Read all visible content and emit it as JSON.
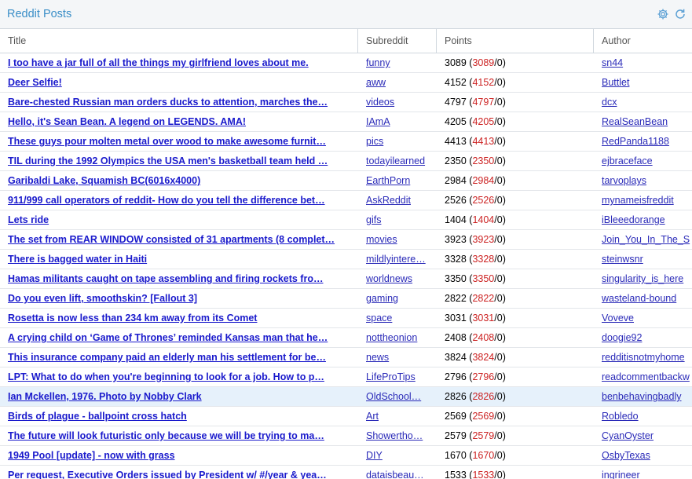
{
  "panel": {
    "title": "Reddit Posts",
    "icons": [
      "gear-icon",
      "refresh-icon"
    ],
    "accent": "#3a8ec7"
  },
  "columns": [
    "Title",
    "Subreddit",
    "Points",
    "Author"
  ],
  "rows": [
    {
      "title": "I too have a jar full of all the things my girlfriend loves about me.",
      "subreddit": "funny",
      "points": "3089",
      "ups": "3089",
      "downs": "0",
      "author": "sn44"
    },
    {
      "title": "Deer Selfie!",
      "subreddit": "aww",
      "points": "4152",
      "ups": "4152",
      "downs": "0",
      "author": "Buttlet"
    },
    {
      "title": "Bare-chested Russian man orders ducks to attention, marches the…",
      "subreddit": "videos",
      "points": "4797",
      "ups": "4797",
      "downs": "0",
      "author": "dcx"
    },
    {
      "title": "Hello, it's Sean Bean. A legend on LEGENDS. AMA!",
      "subreddit": "IAmA",
      "points": "4205",
      "ups": "4205",
      "downs": "0",
      "author": "RealSeanBean"
    },
    {
      "title": "These guys pour molten metal over wood to make awesome furnit…",
      "subreddit": "pics",
      "points": "4413",
      "ups": "4413",
      "downs": "0",
      "author": "RedPanda1188"
    },
    {
      "title": "TIL during the 1992 Olympics the USA men's basketball team held …",
      "subreddit": "todayilearned",
      "points": "2350",
      "ups": "2350",
      "downs": "0",
      "author": "ejbraceface"
    },
    {
      "title": "Garibaldi Lake, Squamish BC(6016x4000)",
      "subreddit": "EarthPorn",
      "points": "2984",
      "ups": "2984",
      "downs": "0",
      "author": "tarvoplays"
    },
    {
      "title": "911/999 call operators of reddit- How do you tell the difference bet…",
      "subreddit": "AskReddit",
      "points": "2526",
      "ups": "2526",
      "downs": "0",
      "author": "mynameisfreddit"
    },
    {
      "title": "Lets ride",
      "subreddit": "gifs",
      "points": "1404",
      "ups": "1404",
      "downs": "0",
      "author": "iBleeedorange"
    },
    {
      "title": "The set from REAR WINDOW consisted of 31 apartments (8 complet…",
      "subreddit": "movies",
      "points": "3923",
      "ups": "3923",
      "downs": "0",
      "author": "Join_You_In_The_S"
    },
    {
      "title": "There is bagged water in Haiti",
      "subreddit": "mildlyintere…",
      "points": "3328",
      "ups": "3328",
      "downs": "0",
      "author": "steinwsnr"
    },
    {
      "title": "Hamas militants caught on tape assembling and firing rockets fro…",
      "subreddit": "worldnews",
      "points": "3350",
      "ups": "3350",
      "downs": "0",
      "author": "singularity_is_here"
    },
    {
      "title": "Do you even lift, smoothskin? [Fallout 3]",
      "subreddit": "gaming",
      "points": "2822",
      "ups": "2822",
      "downs": "0",
      "author": "wasteland-bound"
    },
    {
      "title": "Rosetta is now less than 234 km away from its Comet",
      "subreddit": "space",
      "points": "3031",
      "ups": "3031",
      "downs": "0",
      "author": "Voveve"
    },
    {
      "title": "A crying child on ‘Game of Thrones’ reminded Kansas man that he…",
      "subreddit": "nottheonion",
      "points": "2408",
      "ups": "2408",
      "downs": "0",
      "author": "doogie92"
    },
    {
      "title": "This insurance company paid an elderly man his settlement for be…",
      "subreddit": "news",
      "points": "3824",
      "ups": "3824",
      "downs": "0",
      "author": "redditisnotmyhome"
    },
    {
      "title": "LPT: What to do when you're beginning to look for a job. How to p…",
      "subreddit": "LifeProTips",
      "points": "2796",
      "ups": "2796",
      "downs": "0",
      "author": "readcommentbackw"
    },
    {
      "title": "Ian Mckellen, 1976. Photo by Nobby Clark",
      "subreddit": "OldSchool…",
      "points": "2826",
      "ups": "2826",
      "downs": "0",
      "author": "benbehavingbadly",
      "selected": true
    },
    {
      "title": "Birds of plague - ballpoint cross hatch",
      "subreddit": "Art",
      "points": "2569",
      "ups": "2569",
      "downs": "0",
      "author": "Robledo"
    },
    {
      "title": "The future will look futuristic only because we will be trying to ma…",
      "subreddit": "Showertho…",
      "points": "2579",
      "ups": "2579",
      "downs": "0",
      "author": "CyanOyster"
    },
    {
      "title": "1949 Pool [update] - now with grass",
      "subreddit": "DIY",
      "points": "1670",
      "ups": "1670",
      "downs": "0",
      "author": "OsbyTexas"
    },
    {
      "title": "Per request, Executive Orders issued by President w/ #/year & yea…",
      "subreddit": "dataisbeau…",
      "points": "1533",
      "ups": "1533",
      "downs": "0",
      "author": "ingrineer"
    }
  ]
}
